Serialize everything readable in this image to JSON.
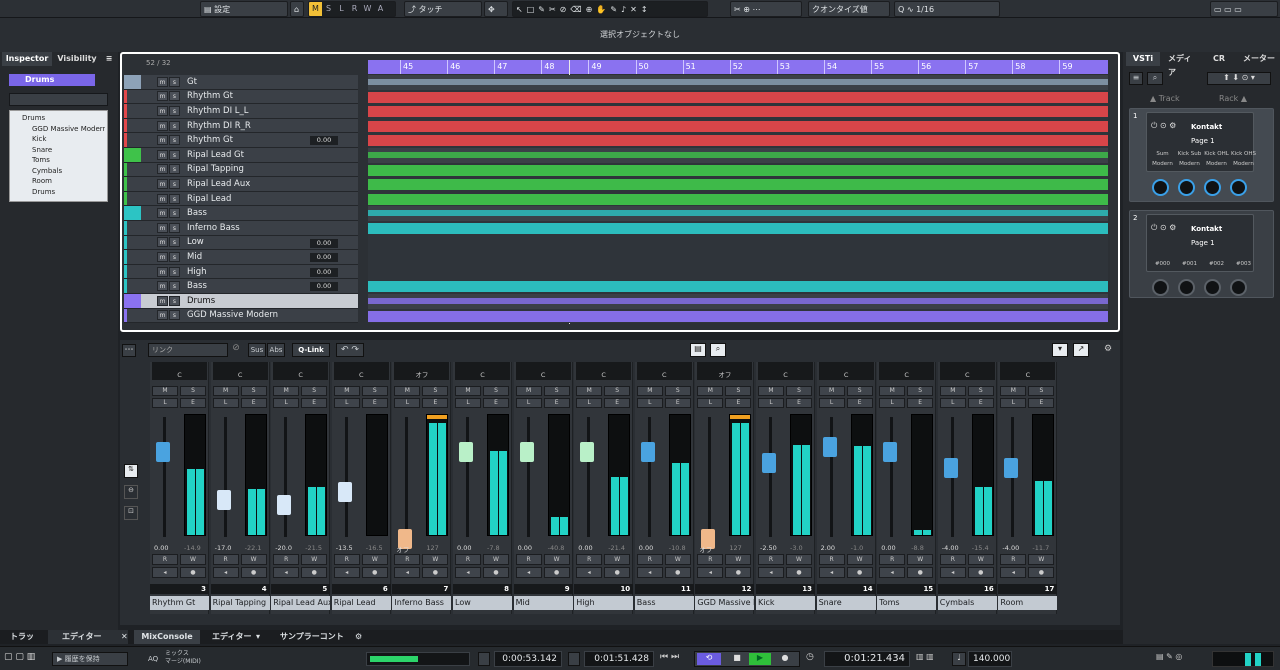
{
  "toolbar": {
    "settings_label": "設定",
    "modes": [
      "M",
      "S",
      "L",
      "R",
      "W",
      "A"
    ],
    "touch_label": "タッチ",
    "quantize_label": "クオンタイズ値",
    "grid_value": "1/16"
  },
  "status": {
    "no_selection": "選択オブジェクトなし"
  },
  "left": {
    "tabs": [
      "Inspector",
      "Visibility"
    ],
    "selected_track": "Drums",
    "tree": [
      "Drums",
      "GGD Massive Modern",
      "Kick",
      "Snare",
      "Toms",
      "Cymbals",
      "Room",
      "Drums"
    ]
  },
  "project": {
    "counter": "52 / 32",
    "bars": [
      "45",
      "46",
      "47",
      "48",
      "49",
      "50",
      "51",
      "52",
      "53",
      "54",
      "55",
      "56",
      "57",
      "58",
      "59"
    ],
    "tracks": [
      {
        "name": "Gt",
        "color": "#8da2b8",
        "val": ""
      },
      {
        "name": "Rhythm Gt",
        "color": "#e2474a",
        "val": ""
      },
      {
        "name": "Rhythm DI L_L",
        "color": "#e2474a",
        "val": ""
      },
      {
        "name": "Rhythm DI R_R",
        "color": "#e2474a",
        "val": ""
      },
      {
        "name": "Rhythm Gt",
        "color": "#e2474a",
        "val": "0.00"
      },
      {
        "name": "Ripal Lead Gt",
        "color": "#3fc24a",
        "val": ""
      },
      {
        "name": "Ripal Tapping",
        "color": "#3fc24a",
        "val": ""
      },
      {
        "name": "Ripal Lead Aux",
        "color": "#3fc24a",
        "val": ""
      },
      {
        "name": "Ripal Lead",
        "color": "#3fc24a",
        "val": ""
      },
      {
        "name": "Bass",
        "color": "#2cc4c4",
        "val": ""
      },
      {
        "name": "Inferno Bass",
        "color": "#2cc4c4",
        "val": ""
      },
      {
        "name": "Low",
        "color": "#2cc4c4",
        "val": "0.00"
      },
      {
        "name": "Mid",
        "color": "#2cc4c4",
        "val": "0.00"
      },
      {
        "name": "High",
        "color": "#2cc4c4",
        "val": "0.00"
      },
      {
        "name": "Bass",
        "color": "#2cc4c4",
        "val": "0.00"
      },
      {
        "name": "Drums",
        "color": "#8a72f0",
        "val": ""
      },
      {
        "name": "GGD Massive Modern",
        "color": "#8a72f0",
        "val": ""
      }
    ]
  },
  "right": {
    "tabs": [
      "VSTi",
      "メディア",
      "CR",
      "メーター"
    ],
    "track_label": "Track",
    "rack_label": "Rack",
    "slots": [
      {
        "num": "1",
        "name": "Kontakt",
        "page": "Page 1",
        "params": [
          "Sum",
          "Kick Sub",
          "Kick OHL",
          "Kick OHS"
        ],
        "sub": [
          "Modern",
          "Modern",
          "Modern",
          "Modern"
        ]
      },
      {
        "num": "2",
        "name": "Kontakt",
        "page": "Page 1",
        "params": [
          "#000",
          "#001",
          "#002",
          "#003"
        ],
        "sub": []
      }
    ]
  },
  "mixer": {
    "link_label": "リンク",
    "sus_label": "Sus",
    "abs_label": "Abs",
    "qlink_label": "Q-Link",
    "channels": [
      {
        "num": "3",
        "name": "Rhythm Gt",
        "pan": "C",
        "val": "0.00",
        "peak": "-14.9",
        "fader": 0.78,
        "level": 0.55,
        "fc": "#4aa3e0"
      },
      {
        "num": "4",
        "name": "Ripal Tapping",
        "pan": "C",
        "val": "-17.0",
        "peak": "-22.1",
        "fader": 0.35,
        "level": 0.38,
        "fc": "#d8e8f8"
      },
      {
        "num": "5",
        "name": "Ripal Lead Aux",
        "pan": "C",
        "val": "-20.0",
        "peak": "-21.5",
        "fader": 0.3,
        "level": 0.4,
        "fc": "#d8e8f8"
      },
      {
        "num": "6",
        "name": "Ripal Lead",
        "pan": "C",
        "val": "-13.5",
        "peak": "-16.5",
        "fader": 0.42,
        "level": 0.0,
        "fc": "#d8e8f8"
      },
      {
        "num": "7",
        "name": "Inferno Bass",
        "pan": "オフ",
        "val": "オフ",
        "peak": "127",
        "fader": 0.0,
        "level": 0.93,
        "fc": "#f0b88a"
      },
      {
        "num": "8",
        "name": "Low",
        "pan": "C",
        "val": "0.00",
        "peak": "-7.8",
        "fader": 0.78,
        "level": 0.7,
        "fc": "#b9f0c8"
      },
      {
        "num": "9",
        "name": "Mid",
        "pan": "C",
        "val": "0.00",
        "peak": "-40.8",
        "fader": 0.78,
        "level": 0.15,
        "fc": "#b9f0c8"
      },
      {
        "num": "10",
        "name": "High",
        "pan": "C",
        "val": "0.00",
        "peak": "-21.4",
        "fader": 0.78,
        "level": 0.48,
        "fc": "#b9f0c8"
      },
      {
        "num": "11",
        "name": "Bass",
        "pan": "C",
        "val": "0.00",
        "peak": "-10.8",
        "fader": 0.78,
        "level": 0.6,
        "fc": "#4aa3e0"
      },
      {
        "num": "12",
        "name": "GGD Massive M",
        "pan": "オフ",
        "val": "オフ",
        "peak": "127",
        "fader": 0.0,
        "level": 0.93,
        "fc": "#f0b88a"
      },
      {
        "num": "13",
        "name": "Kick",
        "pan": "C",
        "val": "-2.50",
        "peak": "-3.0",
        "fader": 0.68,
        "level": 0.75,
        "fc": "#4aa3e0"
      },
      {
        "num": "14",
        "name": "Snare",
        "pan": "C",
        "val": "2.00",
        "peak": "-1.0",
        "fader": 0.82,
        "level": 0.74,
        "fc": "#4aa3e0"
      },
      {
        "num": "15",
        "name": "Toms",
        "pan": "C",
        "val": "0.00",
        "peak": "-8.8",
        "fader": 0.78,
        "level": 0.04,
        "fc": "#4aa3e0"
      },
      {
        "num": "16",
        "name": "Cymbals",
        "pan": "C",
        "val": "-4.00",
        "peak": "-15.4",
        "fader": 0.63,
        "level": 0.4,
        "fc": "#4aa3e0"
      },
      {
        "num": "17",
        "name": "Room",
        "pan": "C",
        "val": "-4.00",
        "peak": "-11.7",
        "fader": 0.63,
        "level": 0.45,
        "fc": "#4aa3e0"
      }
    ]
  },
  "bottom": {
    "tabs": [
      "トラック",
      "エディター",
      "MixConsole",
      "エディター",
      "サンプラーコントロール"
    ],
    "history_label": "履歴を保持",
    "aq": "AQ",
    "mix_label": "ミックス",
    "mix_sub": "マージ(MIDI)"
  },
  "transport": {
    "left_locator": "0:00:53.142",
    "right_locator": "0:01:51.428",
    "position": "0:01:21.434",
    "tempo": "140.000"
  }
}
